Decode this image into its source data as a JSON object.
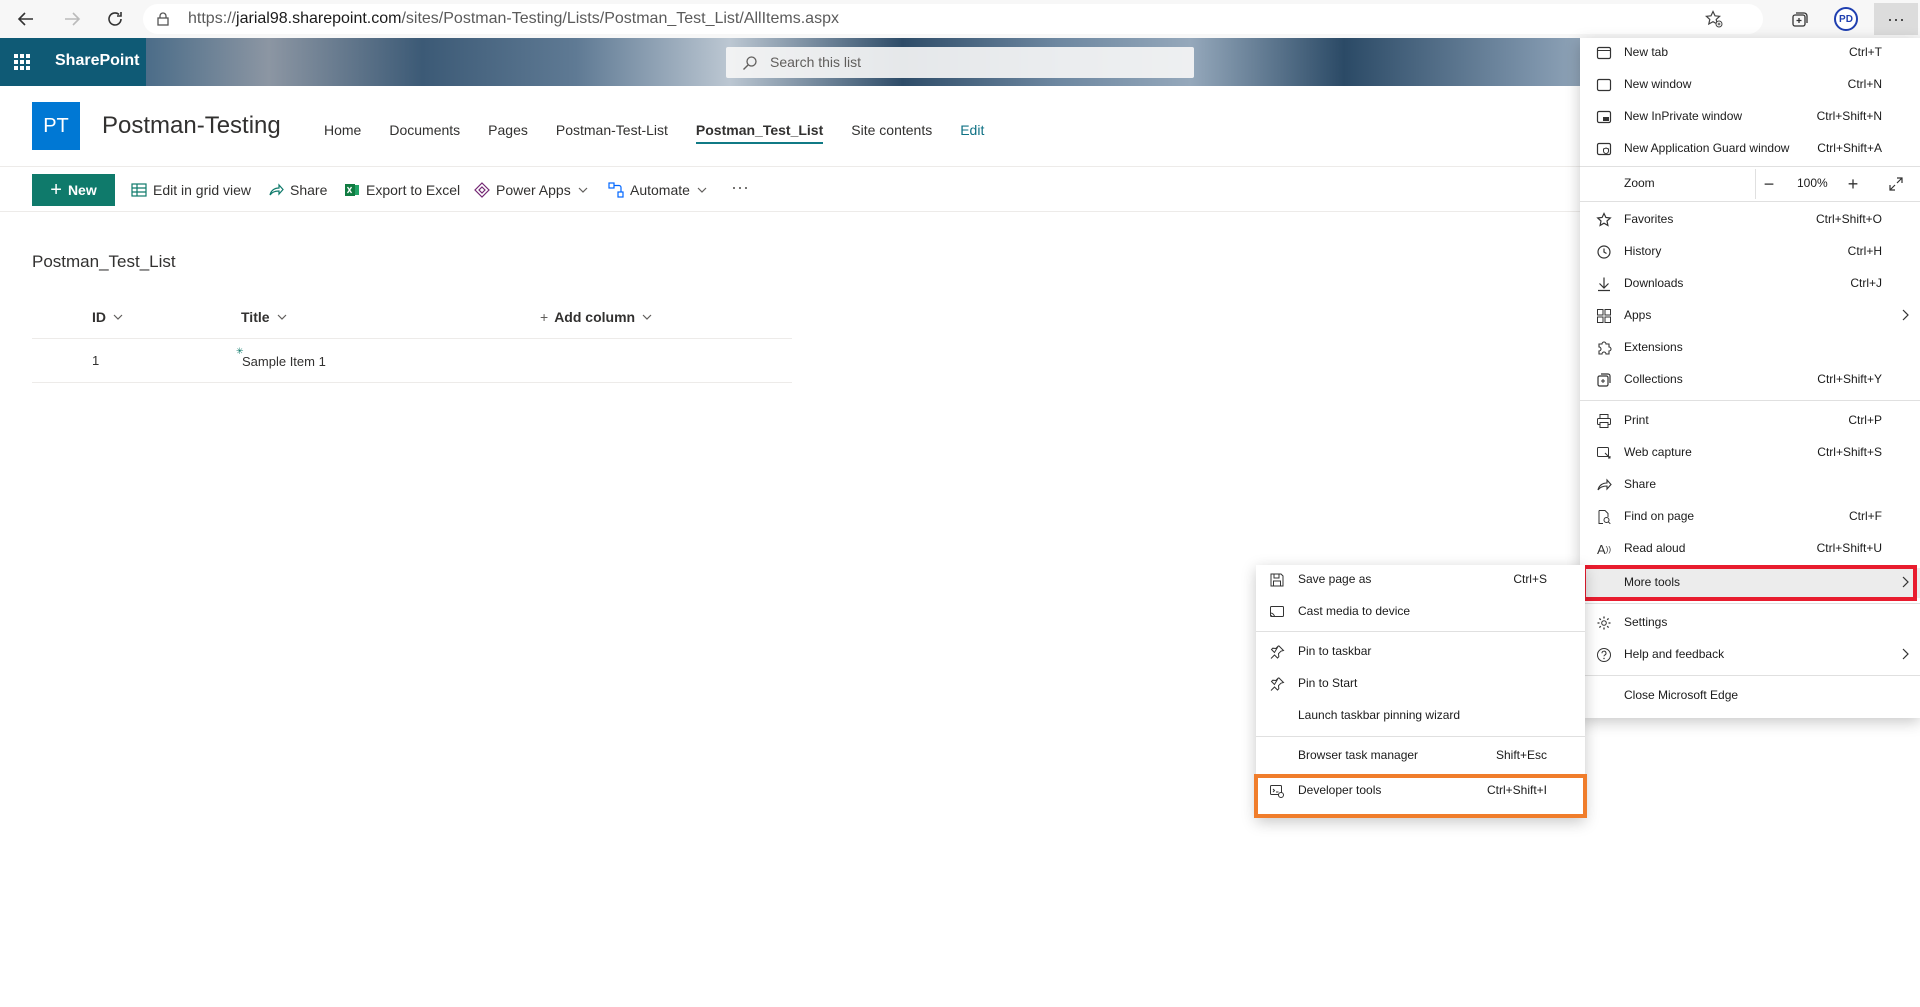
{
  "browser": {
    "url_prefix": "https://",
    "url_host": "jarial98.sharepoint.com",
    "url_path": "/sites/Postman-Testing/Lists/Postman_Test_List/AllItems.aspx",
    "avatar_initials": "PD",
    "more_label": "···"
  },
  "suite": {
    "brand": "SharePoint",
    "search_placeholder": "Search this list"
  },
  "site": {
    "logo_initials": "PT",
    "title": "Postman-Testing",
    "nav": [
      "Home",
      "Documents",
      "Pages",
      "Postman-Test-List",
      "Postman_Test_List",
      "Site contents",
      "Edit"
    ],
    "active_nav": "Postman_Test_List"
  },
  "commands": {
    "new": "New",
    "edit_grid": "Edit in grid view",
    "share": "Share",
    "export": "Export to Excel",
    "power_apps": "Power Apps",
    "automate": "Automate",
    "overflow": "···"
  },
  "list": {
    "title": "Postman_Test_List",
    "columns": {
      "id": "ID",
      "title": "Title",
      "add": "Add column"
    },
    "rows": [
      {
        "id": "1",
        "title": "Sample Item 1"
      }
    ]
  },
  "edge_menu": {
    "new_tab": {
      "label": "New tab",
      "shortcut": "Ctrl+T"
    },
    "new_window": {
      "label": "New window",
      "shortcut": "Ctrl+N"
    },
    "new_inprivate": {
      "label": "New InPrivate window",
      "shortcut": "Ctrl+Shift+N"
    },
    "new_appguard": {
      "label": "New Application Guard window",
      "shortcut": "Ctrl+Shift+A"
    },
    "zoom": {
      "label": "Zoom",
      "value": "100%"
    },
    "favorites": {
      "label": "Favorites",
      "shortcut": "Ctrl+Shift+O"
    },
    "history": {
      "label": "History",
      "shortcut": "Ctrl+H"
    },
    "downloads": {
      "label": "Downloads",
      "shortcut": "Ctrl+J"
    },
    "apps": {
      "label": "Apps"
    },
    "extensions": {
      "label": "Extensions"
    },
    "collections": {
      "label": "Collections",
      "shortcut": "Ctrl+Shift+Y"
    },
    "print": {
      "label": "Print",
      "shortcut": "Ctrl+P"
    },
    "web_capture": {
      "label": "Web capture",
      "shortcut": "Ctrl+Shift+S"
    },
    "share": {
      "label": "Share"
    },
    "find": {
      "label": "Find on page",
      "shortcut": "Ctrl+F"
    },
    "read_aloud": {
      "label": "Read aloud",
      "shortcut": "Ctrl+Shift+U"
    },
    "more_tools": {
      "label": "More tools"
    },
    "settings": {
      "label": "Settings"
    },
    "help": {
      "label": "Help and feedback"
    },
    "close": {
      "label": "Close Microsoft Edge"
    }
  },
  "more_tools_menu": {
    "save_page": {
      "label": "Save page as",
      "shortcut": "Ctrl+S"
    },
    "cast": {
      "label": "Cast media to device"
    },
    "pin_taskbar": {
      "label": "Pin to taskbar"
    },
    "pin_start": {
      "label": "Pin to Start"
    },
    "pin_wizard": {
      "label": "Launch taskbar pinning wizard"
    },
    "task_manager": {
      "label": "Browser task manager",
      "shortcut": "Shift+Esc"
    },
    "dev_tools": {
      "label": "Developer tools",
      "shortcut": "Ctrl+Shift+I"
    }
  },
  "colors": {
    "more_tools_highlight": "#e81c2e",
    "dev_tools_highlight": "#f07d2b",
    "accent": "#0f7a6b",
    "logo": "#0078d4"
  }
}
